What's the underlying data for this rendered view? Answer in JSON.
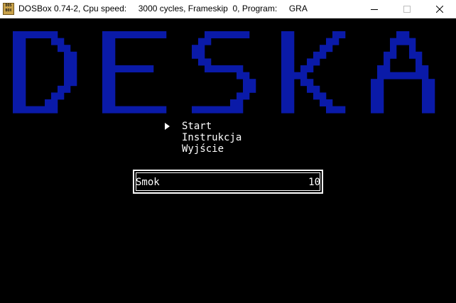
{
  "window": {
    "icon_text": "DOS BOX",
    "title": "DOSBox 0.74-2, Cpu speed:     3000 cycles, Frameskip  0, Program:     GRA",
    "minimize_icon": "minimize-icon",
    "maximize_icon": "maximize-icon",
    "close_icon": "close-icon"
  },
  "game": {
    "logo": "DESKA",
    "logo_color": "#0a1aa8",
    "menu": [
      {
        "label": "Start",
        "selected": true
      },
      {
        "label": "Instrukcja",
        "selected": false
      },
      {
        "label": "Wyjście",
        "selected": false
      }
    ],
    "score": {
      "name": "Smok",
      "value": "10"
    }
  }
}
